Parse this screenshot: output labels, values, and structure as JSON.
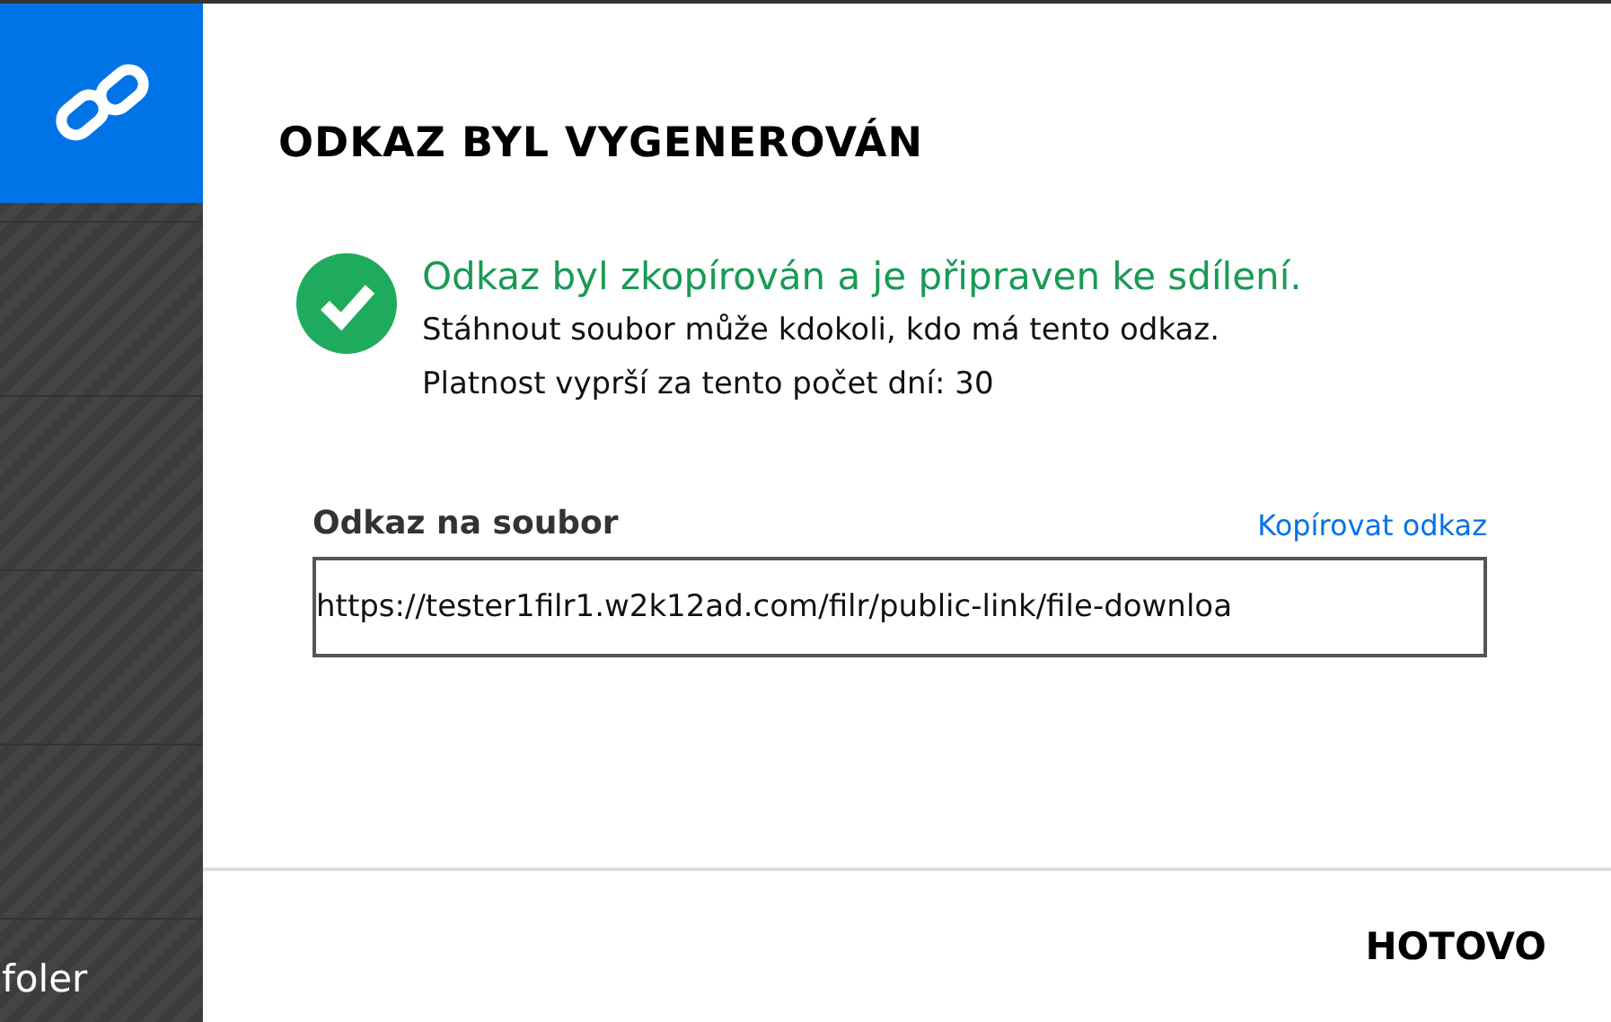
{
  "sidebar": {
    "items": [
      {
        "label": "foler"
      }
    ]
  },
  "dialog": {
    "title": "ODKAZ BYL VYGENEROVÁN",
    "message": {
      "headline": "Odkaz byl zkopírován a je připraven ke sdílení.",
      "lines": [
        "Stáhnout soubor může kdokoli, kdo má tento odkaz.",
        "Platnost vyprší za tento počet dní: 30"
      ]
    },
    "link_field": {
      "label": "Odkaz na soubor",
      "action": "Kopírovat odkaz",
      "value": "https://tester1filr1.w2k12ad.com/filr/public-link/file-downloa"
    },
    "buttons": [
      "HOTOVO"
    ]
  }
}
